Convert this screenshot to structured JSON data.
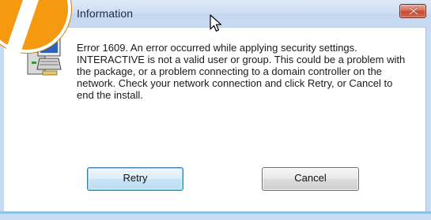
{
  "dialog": {
    "title": "Information",
    "message": "Error 1609. An error occurred while applying security settings. INTERACTIVE is not a valid user or group. This could be a problem with the package, or a problem connecting to a domain controller on the network. Check your network connection and click Retry, or Cancel to end the install.",
    "buttons": {
      "retry": "Retry",
      "cancel": "Cancel"
    },
    "icons": {
      "close": "close-icon",
      "app": "installer-computer-icon",
      "cursor": "mouse-pointer-icon",
      "badge": "step-number-badge"
    }
  },
  "colors": {
    "titlebar": "#c9dbf1",
    "close_button": "#c94a33",
    "badge": "#f59a10",
    "default_button_border": "#3c7fb1"
  }
}
